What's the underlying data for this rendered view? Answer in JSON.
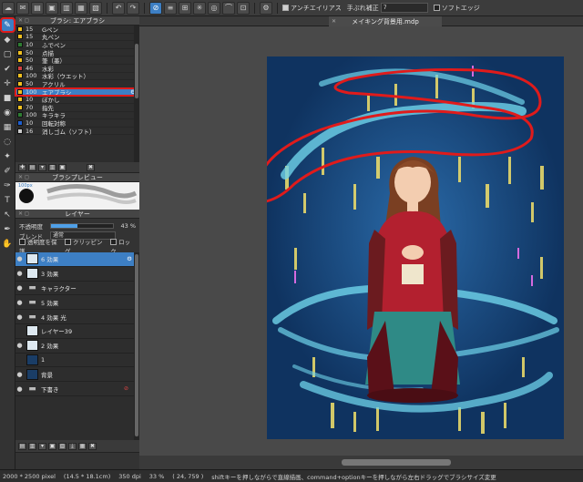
{
  "toolbar": {
    "antialias_label": "アンチエイリアス",
    "stabilizer_label": "手ぶれ補正",
    "stabilizer_value": "7",
    "soft_edge_label": "ソフトエッジ",
    "stabilizer_options": [
      "7"
    ]
  },
  "tools": [
    {
      "name": "brush-tool",
      "glyph": "✎"
    },
    {
      "name": "eraser-tool",
      "glyph": "◆"
    },
    {
      "name": "select-rect-tool",
      "glyph": "▢"
    },
    {
      "name": "check-tool",
      "glyph": "✔"
    },
    {
      "name": "move-tool",
      "glyph": "✛"
    },
    {
      "name": "fill-rect-tool",
      "glyph": "■"
    },
    {
      "name": "bucket-tool",
      "glyph": "◉"
    },
    {
      "name": "gradient-tool",
      "glyph": "▦"
    },
    {
      "name": "lasso-select-tool",
      "glyph": "◌"
    },
    {
      "name": "magic-wand-tool",
      "glyph": "✦"
    },
    {
      "name": "select-pen-tool",
      "glyph": "✐"
    },
    {
      "name": "select-eraser-tool",
      "glyph": "✑"
    },
    {
      "name": "text-tool",
      "glyph": "T"
    },
    {
      "name": "operation-tool",
      "glyph": "↖"
    },
    {
      "name": "eyedropper-tool",
      "glyph": "✒"
    },
    {
      "name": "hand-tool",
      "glyph": "✋"
    }
  ],
  "brush_panel": {
    "title": "ブラシ: エアブラシ",
    "brushes": [
      {
        "size": "15",
        "name": "Gペン",
        "color": "#f0c020"
      },
      {
        "size": "15",
        "name": "丸ペン",
        "color": "#f0c020"
      },
      {
        "size": "10",
        "name": "ふでペン",
        "color": "#2e7d32"
      },
      {
        "size": "50",
        "name": "点描",
        "color": "#f0c020"
      },
      {
        "size": "50",
        "name": "筆（墨）",
        "color": "#f0c020"
      },
      {
        "size": "46",
        "name": "水彩",
        "color": "#d04040"
      },
      {
        "size": "100",
        "name": "水彩（ウエット）",
        "color": "#f0c020"
      },
      {
        "size": "50",
        "name": "アクリル",
        "color": "#f0c020"
      },
      {
        "size": "100",
        "name": "エアブラシ",
        "color": "#f0c020",
        "selected": true
      },
      {
        "size": "10",
        "name": "ぼかし",
        "color": "#f0c020"
      },
      {
        "size": "70",
        "name": "指先",
        "color": "#f0c020"
      },
      {
        "size": "100",
        "name": "キラキラ",
        "color": "#2e7d32"
      },
      {
        "size": "10",
        "name": "回転対称",
        "color": "#1e5fd0"
      },
      {
        "size": "16",
        "name": "消しゴム（ソフト）",
        "color": "#cccccc"
      }
    ]
  },
  "preview_panel": {
    "title": "ブラシプレビュー",
    "size_label": "100px"
  },
  "layer_panel": {
    "title": "レイヤー",
    "opacity_label": "不透明度",
    "opacity_value": "43 %",
    "opacity_fraction": 0.43,
    "blend_label": "ブレンド",
    "blend_value": "通常",
    "protect_alpha": "透明度を保護",
    "clipping": "クリッピング",
    "lock": "ロック",
    "layers": [
      {
        "name": "6 効果",
        "selected": true,
        "thumb": "light",
        "visible": true
      },
      {
        "name": "3 効果",
        "thumb": "light",
        "visible": true
      },
      {
        "name": "キャラクター",
        "thumb": "folder",
        "visible": true
      },
      {
        "name": "5 効果",
        "thumb": "folder",
        "visible": true
      },
      {
        "name": "4 効果 光",
        "thumb": "folder",
        "visible": true
      },
      {
        "name": "レイヤー39",
        "thumb": "light",
        "visible": false
      },
      {
        "name": "2 効果",
        "thumb": "light",
        "visible": true
      },
      {
        "name": "1",
        "thumb": "dark",
        "visible": false
      },
      {
        "name": "背景",
        "thumb": "dark",
        "visible": true
      },
      {
        "name": "下書き",
        "thumb": "folder",
        "visible": true,
        "locked": true
      }
    ]
  },
  "document": {
    "tab_title": "メイキング背景用.mdp"
  },
  "status": {
    "canvas_size": "2000 * 2500 pixel",
    "physical_size": "(14.5 * 18.1cm)",
    "dpi": "350 dpi",
    "zoom": "33 %",
    "cursor": "( 24, 759 )",
    "hint": "shiftキーを押しながらで直線描画、command+optionキーを押しながら左右ドラッグでブラシサイズ変更"
  },
  "colors": {
    "accent": "#3d7fc4",
    "highlight_outline": "#e01b1b",
    "artwork_bg": "#123a66",
    "swirl": "#6fd3ea"
  }
}
